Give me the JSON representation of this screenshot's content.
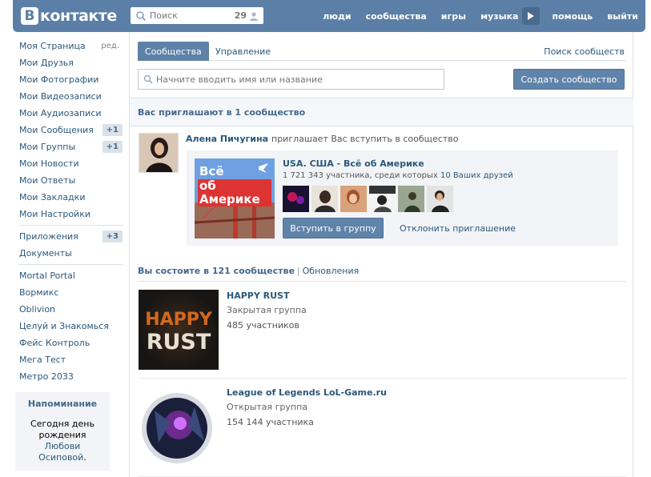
{
  "header": {
    "logo_mark": "В",
    "logo_text": "контакте",
    "search_placeholder": "Поиск",
    "search_count": "29",
    "nav": [
      "люди",
      "сообщества",
      "игры",
      "музыка",
      "помощь",
      "выйти"
    ],
    "accent_color": "#5b7fa6"
  },
  "sidebar": {
    "items": [
      {
        "label": "Моя Страница",
        "extra": "ред."
      },
      {
        "label": "Мои Друзья"
      },
      {
        "label": "Мои Фотографии"
      },
      {
        "label": "Мои Видеозаписи"
      },
      {
        "label": "Мои Аудиозаписи"
      },
      {
        "label": "Мои Сообщения",
        "badge": "+1"
      },
      {
        "label": "Мои Группы",
        "badge": "+1"
      },
      {
        "label": "Мои Новости"
      },
      {
        "label": "Мои Ответы"
      },
      {
        "label": "Мои Закладки"
      },
      {
        "label": "Мои Настройки"
      }
    ],
    "apps": [
      {
        "label": "Приложения",
        "badge": "+3"
      },
      {
        "label": "Документы"
      }
    ],
    "games": [
      "Mortal Portal",
      "Вормикс",
      "Oblivion",
      "Целуй и Знакомься",
      "Фейс Контроль",
      "Мега Тест",
      "Метро 2033"
    ],
    "reminder": {
      "title": "Напоминание",
      "text_before": "Сегодня",
      "text_day": "день рождения",
      "person": "Любови Осиповой",
      "dot": "."
    }
  },
  "main": {
    "tabs": {
      "groups": "Сообщества",
      "manage": "Управление",
      "search": "Поиск сообществ"
    },
    "search_placeholder": "Начните вводить имя или название",
    "create_button": "Создать сообщество",
    "invite_header": "Вас приглашают в 1 сообщество",
    "invite": {
      "inviter_name": "Алена Пичугина",
      "inviter_action": "приглашает Вас вступить в сообщество",
      "group_name": "USA. США - Всё об Америке",
      "cover_line1": "Всё",
      "cover_line2": "об Америке",
      "members_text": "1 721 343 участника, среди которых",
      "friends_text": "10 Ваших друзей",
      "join_button": "Вступить в группу",
      "decline_link": "Отклонить приглашение"
    },
    "member_header": {
      "title": "Вы состоите в 121 сообществе",
      "separator": "|",
      "updates": "Обновления"
    },
    "groups": [
      {
        "name": "HAPPY RUST",
        "type": "Закрытая группа",
        "members": "485 участников",
        "thumb_line1": "HAPPY",
        "thumb_line2": "RUST"
      },
      {
        "name": "League of Legends LoL-Game.ru",
        "type": "Открытая группа",
        "members": "154 144 участника"
      }
    ]
  }
}
